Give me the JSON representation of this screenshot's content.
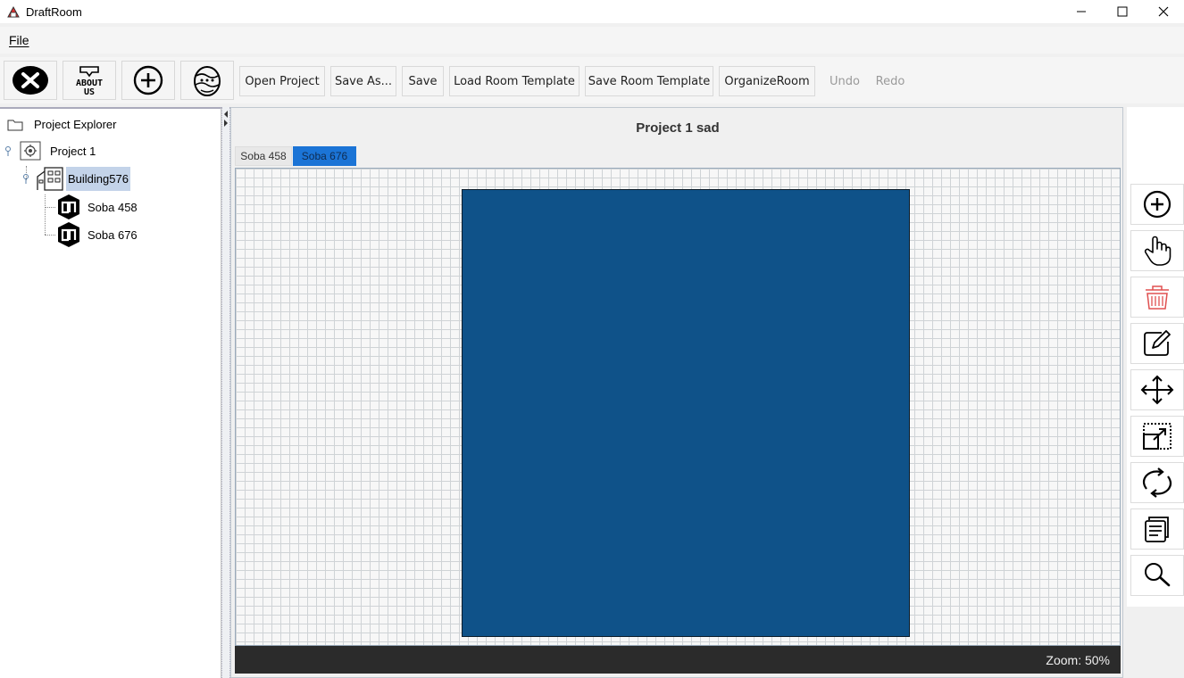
{
  "window": {
    "title": "DraftRoom",
    "controls": [
      "minimize-icon",
      "maximize-icon",
      "close-icon"
    ]
  },
  "menu": {
    "items": [
      {
        "label": "File"
      }
    ]
  },
  "toolbar": {
    "icon_buttons": [
      {
        "name": "exit-button",
        "icon": "close-circle-icon"
      },
      {
        "name": "about-us-button",
        "icon": "about-us-icon",
        "text": "ABOUT US"
      },
      {
        "name": "new-button",
        "icon": "plus-circle-icon"
      },
      {
        "name": "easter-egg-button",
        "icon": "easter-egg-icon"
      }
    ],
    "buttons": [
      {
        "label": "Open Project",
        "enabled": true
      },
      {
        "label": "Save As...",
        "enabled": true
      },
      {
        "label": "Save",
        "enabled": true
      },
      {
        "label": "Load Room Template",
        "enabled": true
      },
      {
        "label": "Save Room Template",
        "enabled": true
      },
      {
        "label": "OrganizeRoom",
        "enabled": true
      },
      {
        "label": "Undo",
        "enabled": false
      },
      {
        "label": "Redo",
        "enabled": false
      }
    ]
  },
  "explorer": {
    "root": {
      "label": "Project Explorer",
      "icon": "folder-icon"
    },
    "project": {
      "label": "Project 1",
      "icon": "project-icon"
    },
    "building": {
      "label": "Building576",
      "icon": "building-icon",
      "selected": true
    },
    "rooms": [
      {
        "label": "Soba 458",
        "icon": "room-icon"
      },
      {
        "label": "Soba 676",
        "icon": "room-icon"
      }
    ]
  },
  "workspace": {
    "project_title": "Project 1 sad",
    "tabs": [
      {
        "label": "Soba 458",
        "active": false
      },
      {
        "label": "Soba 676",
        "active": true
      }
    ],
    "room_color": "#0f5289",
    "zoom_text": "Zoom: 50%"
  },
  "tools": [
    {
      "name": "add-tool",
      "icon": "plus-circle-icon"
    },
    {
      "name": "select-tool",
      "icon": "hand-pointer-icon"
    },
    {
      "name": "delete-tool",
      "icon": "trash-icon",
      "color": "#e05050"
    },
    {
      "name": "edit-tool",
      "icon": "pencil-icon"
    },
    {
      "name": "move-tool",
      "icon": "move-arrows-icon"
    },
    {
      "name": "resize-tool",
      "icon": "resize-icon"
    },
    {
      "name": "rotate-tool",
      "icon": "rotate-icon"
    },
    {
      "name": "copy-tool",
      "icon": "copy-document-icon"
    },
    {
      "name": "zoom-tool",
      "icon": "magnifier-icon"
    }
  ]
}
